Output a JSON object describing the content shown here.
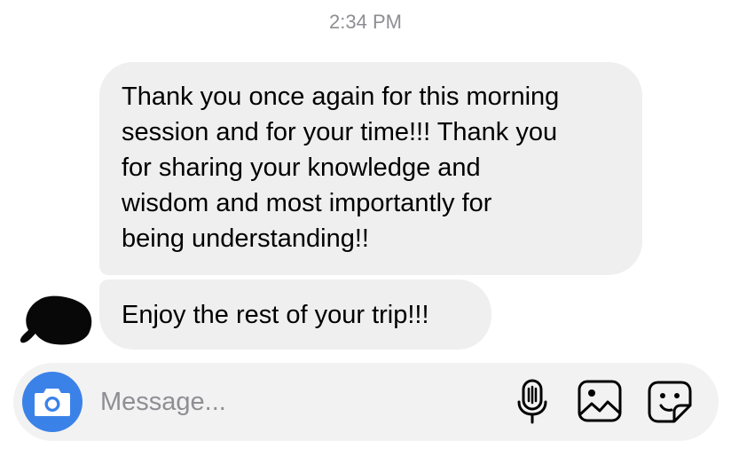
{
  "timestamp": "2:34 PM",
  "messages": [
    {
      "text": "Thank you once again for this morning\nsession and for your time!!! Thank you\nfor sharing your knowledge and\nwisdom and most importantly for\nbeing understanding!!"
    },
    {
      "text": "Enjoy the rest of your trip!!!"
    }
  ],
  "composer": {
    "placeholder": "Message...",
    "icons": [
      "camera-icon",
      "microphone-icon",
      "photo-icon",
      "sticker-icon"
    ]
  },
  "colors": {
    "bubble": "#efefef",
    "composer": "#f2f2f2",
    "camera_accent": "#3b82e8",
    "timestamp": "#8e8e93"
  }
}
